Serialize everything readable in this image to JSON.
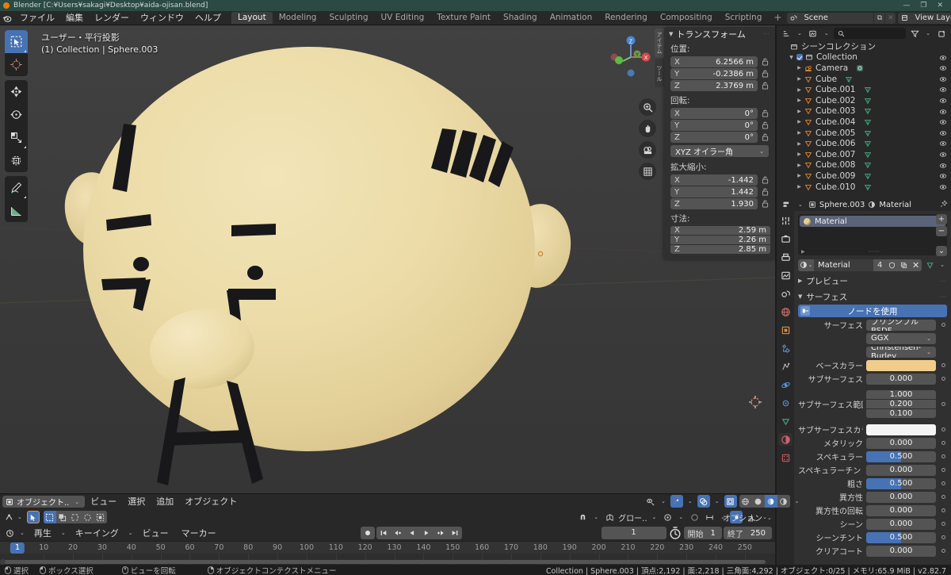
{
  "window": {
    "title": "Blender [C:¥Users¥sakagi¥Desktop¥aida-ojisan.blend]",
    "minimize": "—",
    "maximize": "❐",
    "close": "✕"
  },
  "topbar": {
    "menus": [
      "ファイル",
      "編集",
      "レンダー",
      "ウィンドウ",
      "ヘルプ"
    ],
    "tabs": [
      "Layout",
      "Modeling",
      "Sculpting",
      "UV Editing",
      "Texture Paint",
      "Shading",
      "Animation",
      "Rendering",
      "Compositing",
      "Scripting"
    ],
    "active_tab": "Layout",
    "add_tab": "+",
    "scene": {
      "name": "Scene",
      "copy": "⧉",
      "x": "✕"
    },
    "view_layer": {
      "name": "View Layer",
      "copy": "⧉",
      "x": "✕"
    }
  },
  "viewport": {
    "info_line1": "ユーザー・平行投影",
    "info_line2": "(1) Collection | Sphere.003",
    "gizmo_axes": [
      "X",
      "Y",
      "Z"
    ],
    "nav_buttons": [
      "zoom-icon",
      "hand-icon",
      "camera-icon",
      "grid-icon"
    ],
    "toolbar_tools": [
      "tweak-select-box",
      "cursor",
      "move",
      "rotate",
      "scale",
      "transform",
      "annotate",
      "measure"
    ],
    "header": {
      "mode": "オブジェクト..",
      "menus": [
        "ビュー",
        "選択",
        "追加",
        "オブジェクト"
      ],
      "options_label": "オプション",
      "transform_orientation": "グロー..",
      "select_modes": [
        "tweak",
        "box-select",
        "circle-select",
        "lasso-select"
      ]
    }
  },
  "npanel": {
    "tabs": [
      "アイテム",
      "ツール"
    ],
    "title": "トランスフォーム",
    "sections": {
      "location": {
        "label": "位置:",
        "rows": [
          {
            "axis": "X",
            "value": "6.2566 m"
          },
          {
            "axis": "Y",
            "value": "-0.2386 m"
          },
          {
            "axis": "Z",
            "value": "2.3769 m"
          }
        ]
      },
      "rotation": {
        "label": "回転:",
        "rows": [
          {
            "axis": "X",
            "value": "0°"
          },
          {
            "axis": "Y",
            "value": "0°"
          },
          {
            "axis": "Z",
            "value": "0°"
          }
        ],
        "mode": "XYZ オイラー角"
      },
      "scale": {
        "label": "拡大縮小:",
        "rows": [
          {
            "axis": "X",
            "value": "-1.442"
          },
          {
            "axis": "Y",
            "value": "1.442"
          },
          {
            "axis": "Z",
            "value": "1.930"
          }
        ]
      },
      "dimensions": {
        "label": "寸法:",
        "rows": [
          {
            "axis": "X",
            "value": "2.59 m"
          },
          {
            "axis": "Y",
            "value": "2.26 m"
          },
          {
            "axis": "Z",
            "value": "2.85 m"
          }
        ]
      }
    }
  },
  "outliner": {
    "search_placeholder": "",
    "root": "シーンコレクション",
    "collection": "Collection",
    "items": [
      {
        "name": "Camera",
        "type": "camera",
        "has_data": true
      },
      {
        "name": "Cube",
        "type": "mesh",
        "has_data": true
      },
      {
        "name": "Cube.001",
        "type": "mesh",
        "has_data": true
      },
      {
        "name": "Cube.002",
        "type": "mesh",
        "has_data": true
      },
      {
        "name": "Cube.003",
        "type": "mesh",
        "has_data": true
      },
      {
        "name": "Cube.004",
        "type": "mesh",
        "has_data": true
      },
      {
        "name": "Cube.005",
        "type": "mesh",
        "has_data": true
      },
      {
        "name": "Cube.006",
        "type": "mesh",
        "has_data": true
      },
      {
        "name": "Cube.007",
        "type": "mesh",
        "has_data": true
      },
      {
        "name": "Cube.008",
        "type": "mesh",
        "has_data": true
      },
      {
        "name": "Cube.009",
        "type": "mesh",
        "has_data": true
      },
      {
        "name": "Cube.010",
        "type": "mesh",
        "has_data": true
      }
    ]
  },
  "properties": {
    "breadcrumb": {
      "object": "Sphere.003",
      "material": "Material"
    },
    "slot": {
      "name": "Material"
    },
    "slot_buttons": [
      "+",
      "−",
      "⌄"
    ],
    "material_id": {
      "name": "Material",
      "users": "4",
      "shield": "shield-icon",
      "copy": "copy-icon",
      "unlink": "✕"
    },
    "panels": {
      "preview": "プレビュー",
      "surface": "サーフェス"
    },
    "use_nodes": "ノードを使用",
    "surface_label": "サーフェス",
    "surface_value": "プリンシプルBSDF",
    "distribution": "GGX",
    "subsurface_method": "Christensen-Burley",
    "rows": [
      {
        "label": "ベースカラー",
        "type": "color",
        "color": "#f0cd8b"
      },
      {
        "label": "サブサーフェス",
        "type": "value",
        "value": "0.000",
        "fill": 0
      },
      {
        "label": "サブサーフェス範囲",
        "type": "stack",
        "values": [
          "1.000",
          "0.200",
          "0.100"
        ]
      },
      {
        "label": "サブサーフェスカラー",
        "type": "color",
        "color": "#f4f4f4"
      },
      {
        "label": "メタリック",
        "type": "value",
        "value": "0.000",
        "fill": 0
      },
      {
        "label": "スペキュラー",
        "type": "value",
        "value": "0.500",
        "fill": 50
      },
      {
        "label": "スペキュラーチント",
        "type": "value",
        "value": "0.000",
        "fill": 0
      },
      {
        "label": "粗さ",
        "type": "value",
        "value": "0.500",
        "fill": 50
      },
      {
        "label": "異方性",
        "type": "value",
        "value": "0.000",
        "fill": 0
      },
      {
        "label": "異方性の回転",
        "type": "value",
        "value": "0.000",
        "fill": 0
      },
      {
        "label": "シーン",
        "type": "value",
        "value": "0.000",
        "fill": 0
      },
      {
        "label": "シーンチント",
        "type": "value",
        "value": "0.500",
        "fill": 50
      },
      {
        "label": "クリアコート",
        "type": "value",
        "value": "0.000",
        "fill": 0
      }
    ],
    "tab_icons": [
      "tool-icon",
      "render-icon",
      "output-icon",
      "view-layer-icon",
      "scene-icon",
      "world-icon",
      "object-icon",
      "modifier-icon",
      "particle-icon",
      "physics-icon",
      "constraint-icon",
      "data-icon",
      "material-icon",
      "texture-icon"
    ]
  },
  "timeline": {
    "menus": [
      "再生",
      "キーイング",
      "ビュー",
      "マーカー"
    ],
    "current_frame": "1",
    "start_label": "開始",
    "start_value": "1",
    "end_label": "終了",
    "end_value": "250",
    "ticks": [
      10,
      20,
      30,
      40,
      50,
      60,
      70,
      80,
      90,
      100,
      110,
      120,
      130,
      140,
      150,
      160,
      170,
      180,
      190,
      200,
      210,
      220,
      230,
      240,
      250
    ],
    "playhead": "1"
  },
  "statusbar": {
    "keys": [
      {
        "icon": "mouse-left-icon",
        "label": "選択"
      },
      {
        "icon": "mouse-left-drag-icon",
        "label": "ボックス選択"
      },
      {
        "icon": "mouse-middle-icon",
        "label": "ビューを回転"
      },
      {
        "icon": "mouse-right-icon",
        "label": "オブジェクトコンテクストメニュー"
      }
    ],
    "info": "Collection | Sphere.003 | 頂点:2,192 | 面:2,218 | 三角面:4,292 | オブジェクト:0/25 | メモリ:65.9 MiB | v2.82.7"
  },
  "colors": {
    "accent": "#4772b3",
    "skin": "#e8d7a0",
    "viewport_bg": "#3b3b3b"
  }
}
